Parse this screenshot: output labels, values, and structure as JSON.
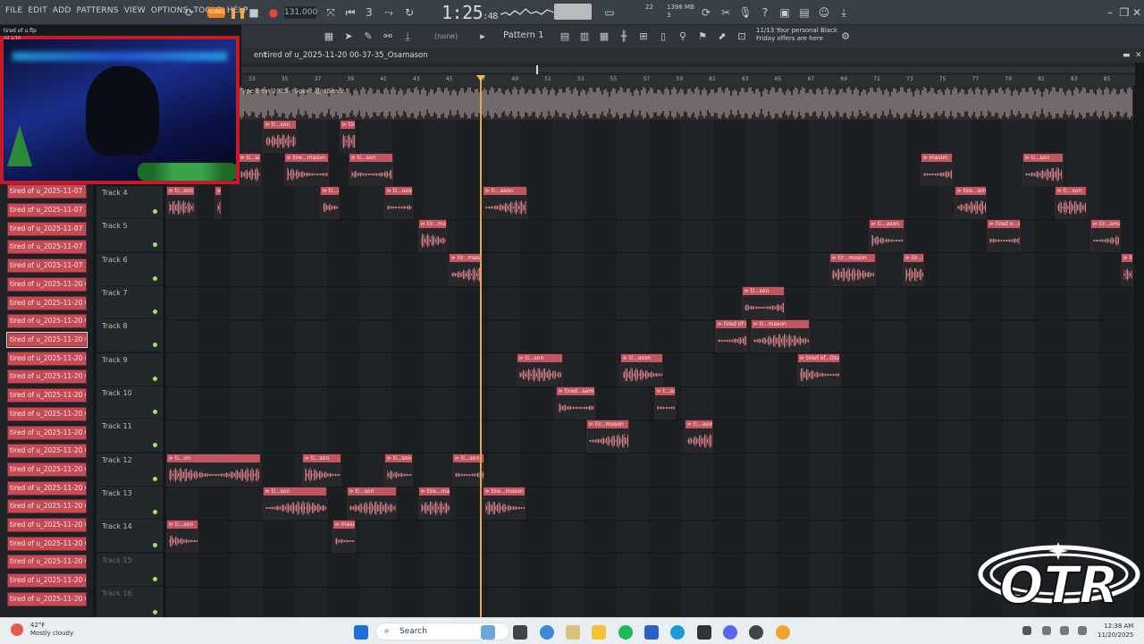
{
  "app": {
    "menu": [
      "FILE",
      "EDIT",
      "ADD",
      "PATTERNS",
      "VIEW",
      "OPTIONS",
      "TOOLS",
      "HELP"
    ],
    "song_mode": "SONG",
    "tempo": "131.000",
    "time_main": "1:25",
    "time_sub": ":48",
    "cpu_mem": "1396 MB",
    "cpu_num": "3",
    "voice_count": "22",
    "pattern": "Pattern 1",
    "none_label": "(none)",
    "promo_line1": "11/13  Your personal Black",
    "promo_line2": "Friday offers are here"
  },
  "playlist": {
    "lead": "ent",
    "breadcrumb": "tired of u_2025-11-20 00-37-35_Osamason",
    "ref_track_label": "Type Beat 2025 - Sober @JpBeatz",
    "ruler_numbers": [
      "33",
      "35",
      "37",
      "39",
      "41",
      "43",
      "45",
      "47",
      "49",
      "51",
      "53",
      "55",
      "57",
      "59",
      "61",
      "63",
      "65",
      "67",
      "69",
      "71",
      "73",
      "75",
      "77",
      "79",
      "81",
      "83",
      "85"
    ]
  },
  "webcam": {
    "title": "tired of u.flp",
    "subtitle": "32 1/16"
  },
  "picker": {
    "items": [
      "tired of u_2025-11-07 14...",
      "tired of u_2025-11-07 14...",
      "tired of u_2025-11-07 14...",
      "tired of u_2025-11-07 14...",
      "tired of u_2025-11-07 14...",
      "tired of u_2025-11-20 00...",
      "tired of u_2025-11-20 00...",
      "tired of u_2025-11-20 00...",
      "tired of u_2025-11-20 00...",
      "tired of u_2025-11-20 00...",
      "tired of u_2025-11-20 00...",
      "tired of u_2025-11-20 00...",
      "tired of u_2025-11-20 00...",
      "tired of u_2025-11-20 00...",
      "tired of u_2025-11-20 00...",
      "tired of u_2025-11-20 00...",
      "tired of u_2025-11-20 00...",
      "tired of u_2025-11-20 00...",
      "tired of u_2025-11-20 00...",
      "tired of u_2025-11-20 00...",
      "tired of u_2025-11-20 00...",
      "tired of u_2025-11-20 00...",
      "tired of u_2025-11-20 00..."
    ]
  },
  "tracks": [
    {
      "name": "Track 4"
    },
    {
      "name": "Track 5"
    },
    {
      "name": "Track 6"
    },
    {
      "name": "Track 7"
    },
    {
      "name": "Track 8"
    },
    {
      "name": "Track 9"
    },
    {
      "name": "Track 10"
    },
    {
      "name": "Track 11"
    },
    {
      "name": "Track 12"
    },
    {
      "name": "Track 13"
    },
    {
      "name": "Track 14"
    },
    {
      "name": "Track 15"
    },
    {
      "name": "Track 16"
    }
  ],
  "clips": [
    {
      "label": "ti...son"
    },
    {
      "label": "tire...mason"
    },
    {
      "label": "tire...mason"
    },
    {
      "label": "ti...son"
    },
    {
      "label": "mason"
    },
    {
      "label": "ti...son"
    },
    {
      "label": "ti...son"
    },
    {
      "label": "ti...son"
    },
    {
      "label": "tir...ason"
    },
    {
      "label": "ti...ason"
    },
    {
      "label": "ti...ason"
    },
    {
      "label": "ti...ason"
    },
    {
      "label": "tire...amason"
    },
    {
      "label": "ti...son"
    },
    {
      "label": "tir...mason"
    },
    {
      "label": "ti...ason"
    },
    {
      "label": "tired o...samason"
    },
    {
      "label": "tir...amason"
    },
    {
      "label": "tir...mason"
    },
    {
      "label": "tir...mason"
    },
    {
      "label": "tir...ason"
    },
    {
      "label": "tir...mason"
    },
    {
      "label": "ti...son"
    },
    {
      "label": "tired of u_20...5-27_Osamason"
    },
    {
      "label": "ti...mason"
    },
    {
      "label": "ti...son"
    },
    {
      "label": "ti...ason"
    },
    {
      "label": "tired of...Osamason"
    },
    {
      "label": "tired...samason"
    },
    {
      "label": "t...son"
    },
    {
      "label": "tir...mason"
    },
    {
      "label": "ti...ason"
    },
    {
      "label": "ti...on"
    },
    {
      "label": "ti...son"
    },
    {
      "label": "ti...son"
    },
    {
      "label": "ti...son"
    },
    {
      "label": "ti...son"
    }
  ],
  "taskbar": {
    "temp": "42°F",
    "weather": "Mostly cloudy",
    "search": "Search",
    "time": "12:38 AM",
    "date": "11/20/2025"
  },
  "watermark": "OTR"
}
